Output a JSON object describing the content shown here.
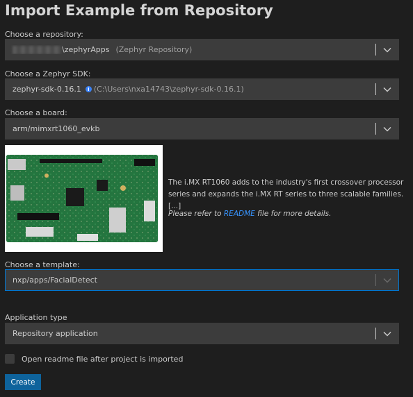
{
  "title": "Import Example from Repository",
  "repository": {
    "label": "Choose a repository:",
    "path_suffix": "\\zephyrApps",
    "description": "(Zephyr Repository)"
  },
  "sdk": {
    "label": "Choose a Zephyr SDK:",
    "name": "zephyr-sdk-0.16.1",
    "info_icon_glyph": "i",
    "path": "(C:\\Users\\nxa14743\\zephyr-sdk-0.16.1)"
  },
  "board": {
    "label": "Choose a board:",
    "value": "arm/mimxrt1060_evkb",
    "description": "The i.MX RT1060 adds to the industry's first crossover processor series and expands the i.MX RT series to three scalable families. [...]",
    "refer_prefix": "Please refer to ",
    "refer_link": "README",
    "refer_suffix": " file for more details."
  },
  "template": {
    "label": "Choose a template:",
    "value": "nxp/apps/FacialDetect"
  },
  "app_type": {
    "label": "Application type",
    "value": "Repository application"
  },
  "open_readme": {
    "label": "Open readme file after project is imported",
    "checked": false
  },
  "create_button": "Create",
  "colors": {
    "background": "#1e1e1e",
    "input_bg": "#3c3c3c",
    "focus_border": "#0078d4",
    "link": "#3794ff",
    "button_bg": "#0e639c"
  }
}
